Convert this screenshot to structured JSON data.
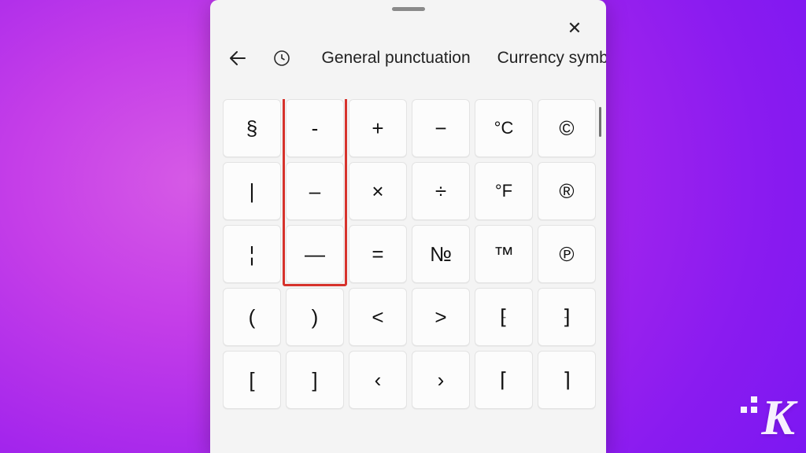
{
  "panel": {
    "close_tooltip": "Close"
  },
  "nav": {
    "tabs": [
      {
        "label": "General punctuation",
        "active": true
      },
      {
        "label": "Currency symbols",
        "active": false
      }
    ]
  },
  "symbols": {
    "rows": [
      [
        "§",
        "-",
        "+",
        "−",
        "°C",
        "©"
      ],
      [
        "|",
        "–",
        "×",
        "÷",
        "°F",
        "®"
      ],
      [
        "¦",
        "—",
        "=",
        "№",
        "™",
        "℗"
      ],
      [
        "(",
        ")",
        "<",
        ">",
        "⁅",
        "⁆"
      ],
      [
        "[",
        "]",
        "‹",
        "›",
        "⌈",
        "⌉"
      ]
    ]
  },
  "highlight": {
    "column_index": 1,
    "row_start": 0,
    "row_end": 2
  },
  "watermark": {
    "text": "K"
  }
}
